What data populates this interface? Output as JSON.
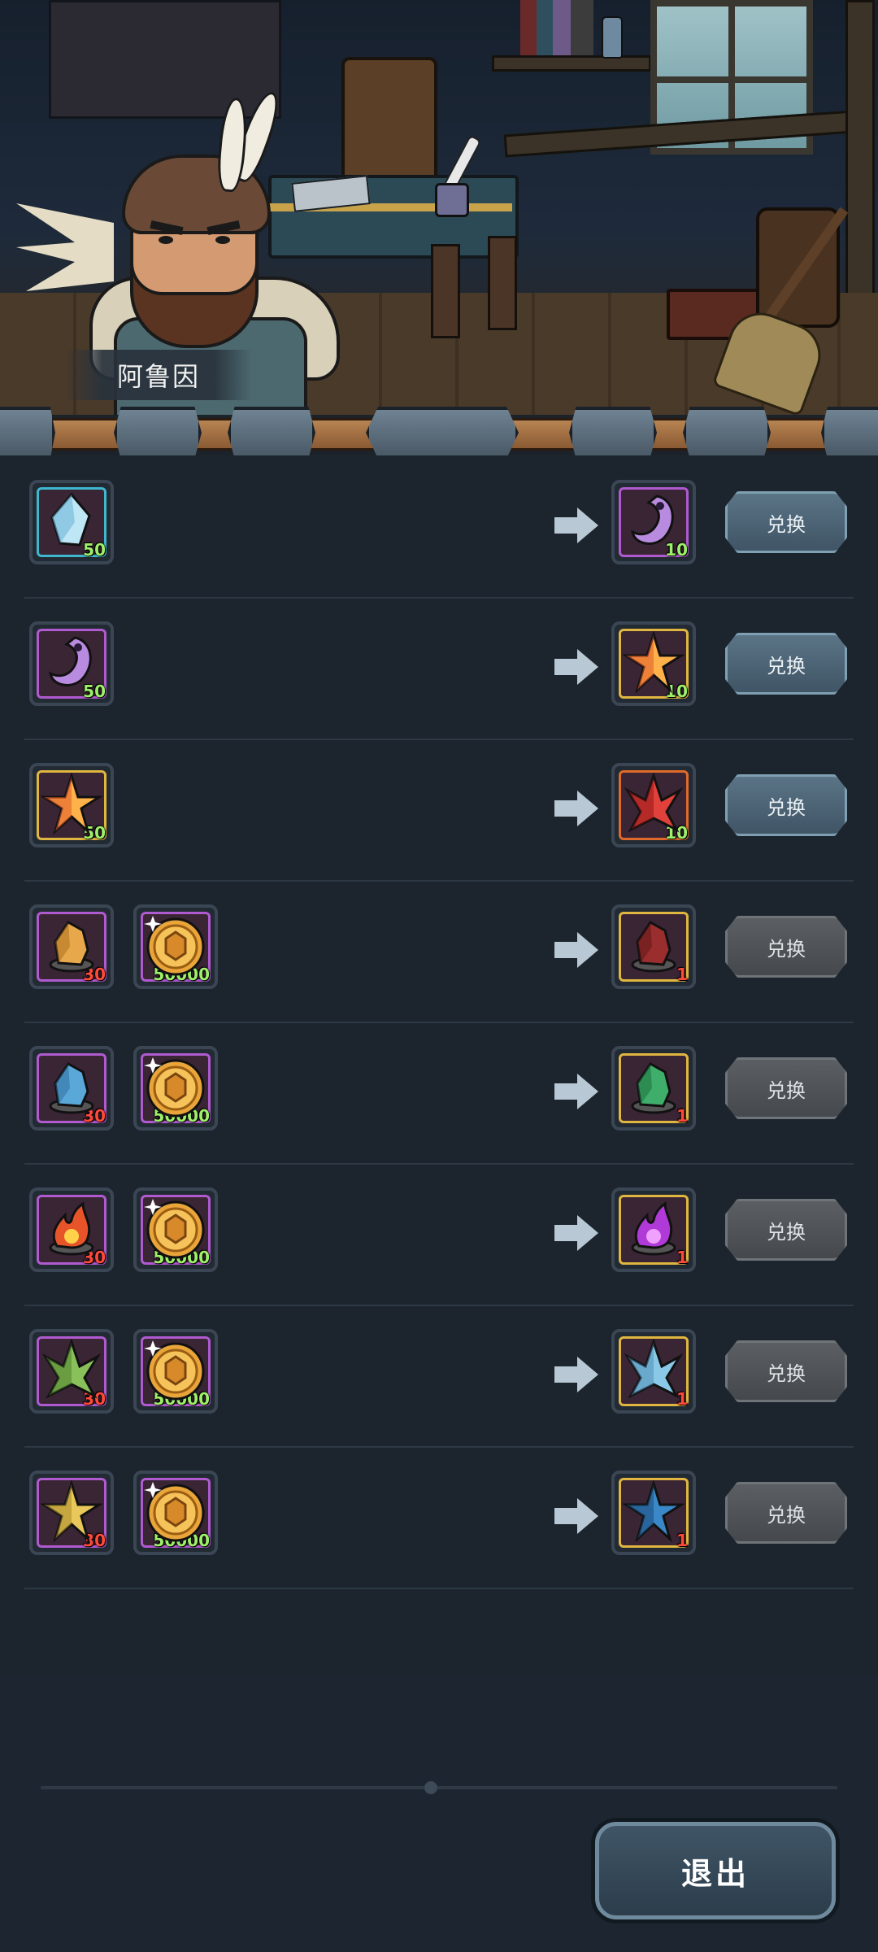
{
  "npc": {
    "name": "阿鲁因"
  },
  "exchange": {
    "button_label": "兑换",
    "rows": [
      {
        "inputs": [
          {
            "item": "blue-crystal-icon",
            "qty": "50",
            "qty_color": "green",
            "frame": "#3fb7cf"
          }
        ],
        "output": {
          "item": "purple-crystal-icon",
          "qty": "10",
          "qty_color": "green",
          "frame": "#b05ad0"
        },
        "button_state": "active"
      },
      {
        "inputs": [
          {
            "item": "purple-crystal-icon",
            "qty": "50",
            "qty_color": "green",
            "frame": "#b05ad0"
          }
        ],
        "output": {
          "item": "gold-crystal-icon",
          "qty": "10",
          "qty_color": "green",
          "frame": "#e0b640"
        },
        "button_state": "active"
      },
      {
        "inputs": [
          {
            "item": "gold-crystal-icon",
            "qty": "50",
            "qty_color": "green",
            "frame": "#e0b640"
          }
        ],
        "output": {
          "item": "red-crystal-icon",
          "qty": "10",
          "qty_color": "green",
          "frame": "#e06a2a"
        },
        "button_state": "active"
      },
      {
        "inputs": [
          {
            "item": "amber-ore-icon",
            "qty": "30",
            "qty_color": "red",
            "frame": "#b05ad0"
          },
          {
            "item": "gold-coin-icon",
            "qty": "50000",
            "qty_color": "green",
            "frame": "#b05ad0"
          }
        ],
        "output": {
          "item": "crimson-ore-icon",
          "qty": "1",
          "qty_color": "red",
          "frame": "#e0b640"
        },
        "button_state": "disabled"
      },
      {
        "inputs": [
          {
            "item": "blue-ore-icon",
            "qty": "30",
            "qty_color": "red",
            "frame": "#b05ad0"
          },
          {
            "item": "gold-coin-icon",
            "qty": "50000",
            "qty_color": "green",
            "frame": "#b05ad0"
          }
        ],
        "output": {
          "item": "green-ore-icon",
          "qty": "1",
          "qty_color": "red",
          "frame": "#e0b640"
        },
        "button_state": "disabled"
      },
      {
        "inputs": [
          {
            "item": "fire-ore-icon",
            "qty": "30",
            "qty_color": "red",
            "frame": "#b05ad0"
          },
          {
            "item": "gold-coin-icon",
            "qty": "50000",
            "qty_color": "green",
            "frame": "#b05ad0"
          }
        ],
        "output": {
          "item": "violet-fire-ore-icon",
          "qty": "1",
          "qty_color": "red",
          "frame": "#e0b640"
        },
        "button_state": "disabled"
      },
      {
        "inputs": [
          {
            "item": "green-shard-ore-icon",
            "qty": "30",
            "qty_color": "red",
            "frame": "#b05ad0"
          },
          {
            "item": "gold-coin-icon",
            "qty": "50000",
            "qty_color": "green",
            "frame": "#b05ad0"
          }
        ],
        "output": {
          "item": "ice-shard-ore-icon",
          "qty": "1",
          "qty_color": "red",
          "frame": "#e0b640"
        },
        "button_state": "disabled"
      },
      {
        "inputs": [
          {
            "item": "yellow-star-ore-icon",
            "qty": "30",
            "qty_color": "red",
            "frame": "#b05ad0"
          },
          {
            "item": "gold-coin-icon",
            "qty": "50000",
            "qty_color": "green",
            "frame": "#b05ad0"
          }
        ],
        "output": {
          "item": "blue-star-ore-icon",
          "qty": "1",
          "qty_color": "red",
          "frame": "#e0b640"
        },
        "button_state": "disabled"
      }
    ]
  },
  "footer": {
    "exit_label": "退出"
  }
}
